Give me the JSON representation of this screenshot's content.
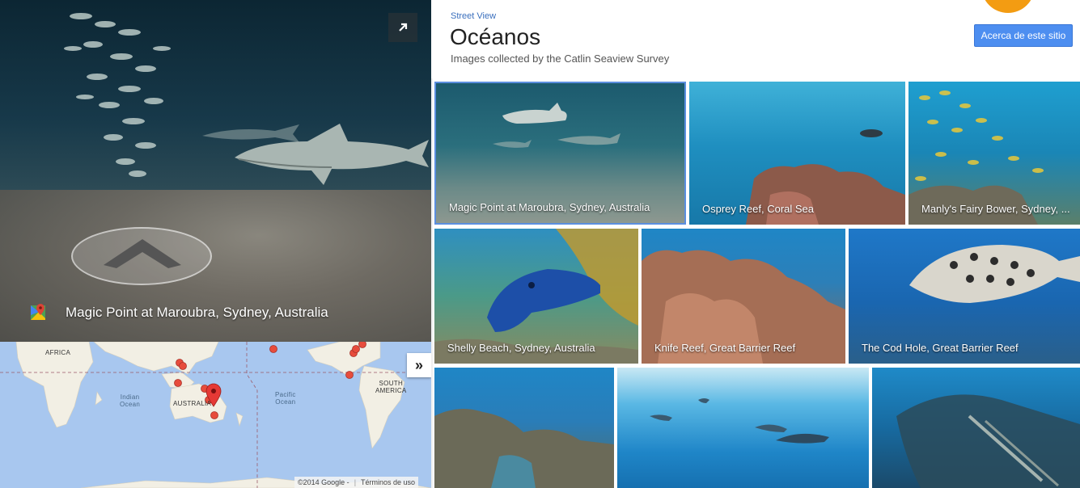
{
  "panorama": {
    "location_caption": "Magic Point at Maroubra, Sydney, Australia"
  },
  "map": {
    "continents": {
      "africa": "AFRICA",
      "australia": "AUSTRALIA",
      "south_america": "SOUTH\nAMERICA"
    },
    "oceans": {
      "indian": "Indian\nOcean",
      "pacific": "Pacific\nOcean"
    },
    "footer": {
      "copyright": "©2014 Google -",
      "terms": "Términos de uso"
    }
  },
  "header": {
    "category_link": "Street View",
    "title": "Océanos",
    "subtitle": "Images collected by the Catlin Seaview Survey",
    "about_button": "Acerca de este sitio"
  },
  "gallery": [
    {
      "label": "Magic Point at Maroubra, Sydney, Australia",
      "selected": true
    },
    {
      "label": "Osprey Reef, Coral Sea",
      "selected": false
    },
    {
      "label": "Manly's Fairy Bower, Sydney, ...",
      "selected": false
    },
    {
      "label": "Shelly Beach, Sydney, Australia",
      "selected": false
    },
    {
      "label": "Knife Reef, Great Barrier Reef",
      "selected": false
    },
    {
      "label": "The Cod Hole, Great Barrier Reef",
      "selected": false
    },
    {
      "label": "",
      "selected": false
    },
    {
      "label": "",
      "selected": false
    },
    {
      "label": "",
      "selected": false
    }
  ],
  "colors": {
    "accent_blue": "#4d8ef0",
    "link_blue": "#3a6fbd",
    "map_water": "#a8c7ef",
    "map_land": "#f2efe4",
    "marker_red": "#e74c3c",
    "badge_orange": "#f39c12"
  }
}
